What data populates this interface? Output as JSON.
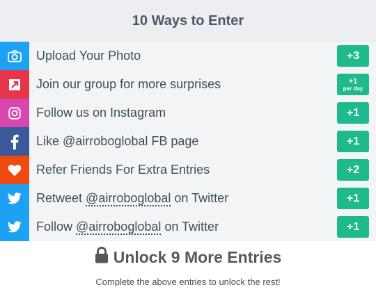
{
  "header": {
    "title": "10 Ways to Enter"
  },
  "entries": [
    {
      "icon": "camera-icon",
      "icon_color": "#1da1f2",
      "label": "Upload Your Photo",
      "badge": "+3"
    },
    {
      "icon": "external-link-icon",
      "icon_color": "#e8354c",
      "label": "Join our group for more surprises",
      "badge": "+1",
      "badge_sub": "per day"
    },
    {
      "icon": "instagram-icon",
      "icon_color": "#d847b0",
      "label": "Follow us on Instagram",
      "badge": "+1"
    },
    {
      "icon": "facebook-icon",
      "icon_color": "#3b5998",
      "label": "Like @airroboglobal FB page",
      "badge": "+1"
    },
    {
      "icon": "heart-icon",
      "icon_color": "#ee4a12",
      "label": "Refer Friends For Extra Entries",
      "badge": "+2"
    },
    {
      "icon": "twitter-icon",
      "icon_color": "#1da1f2",
      "label_prefix": "Retweet ",
      "label_handle": "@airroboglobal",
      "label_suffix": " on Twitter",
      "badge": "+1"
    },
    {
      "icon": "twitter-icon",
      "icon_color": "#1da1f2",
      "label_prefix": "Follow ",
      "label_handle": "@airroboglobal",
      "label_suffix": " on Twitter",
      "badge": "+1"
    }
  ],
  "unlock": {
    "icon": "lock-icon",
    "title": "Unlock 9 More Entries",
    "subtitle": "Complete the above entries to unlock the rest!"
  },
  "colors": {
    "badge": "#1eb98d",
    "row_bg": "#f3f4f6",
    "header_bg": "#eceef1"
  }
}
